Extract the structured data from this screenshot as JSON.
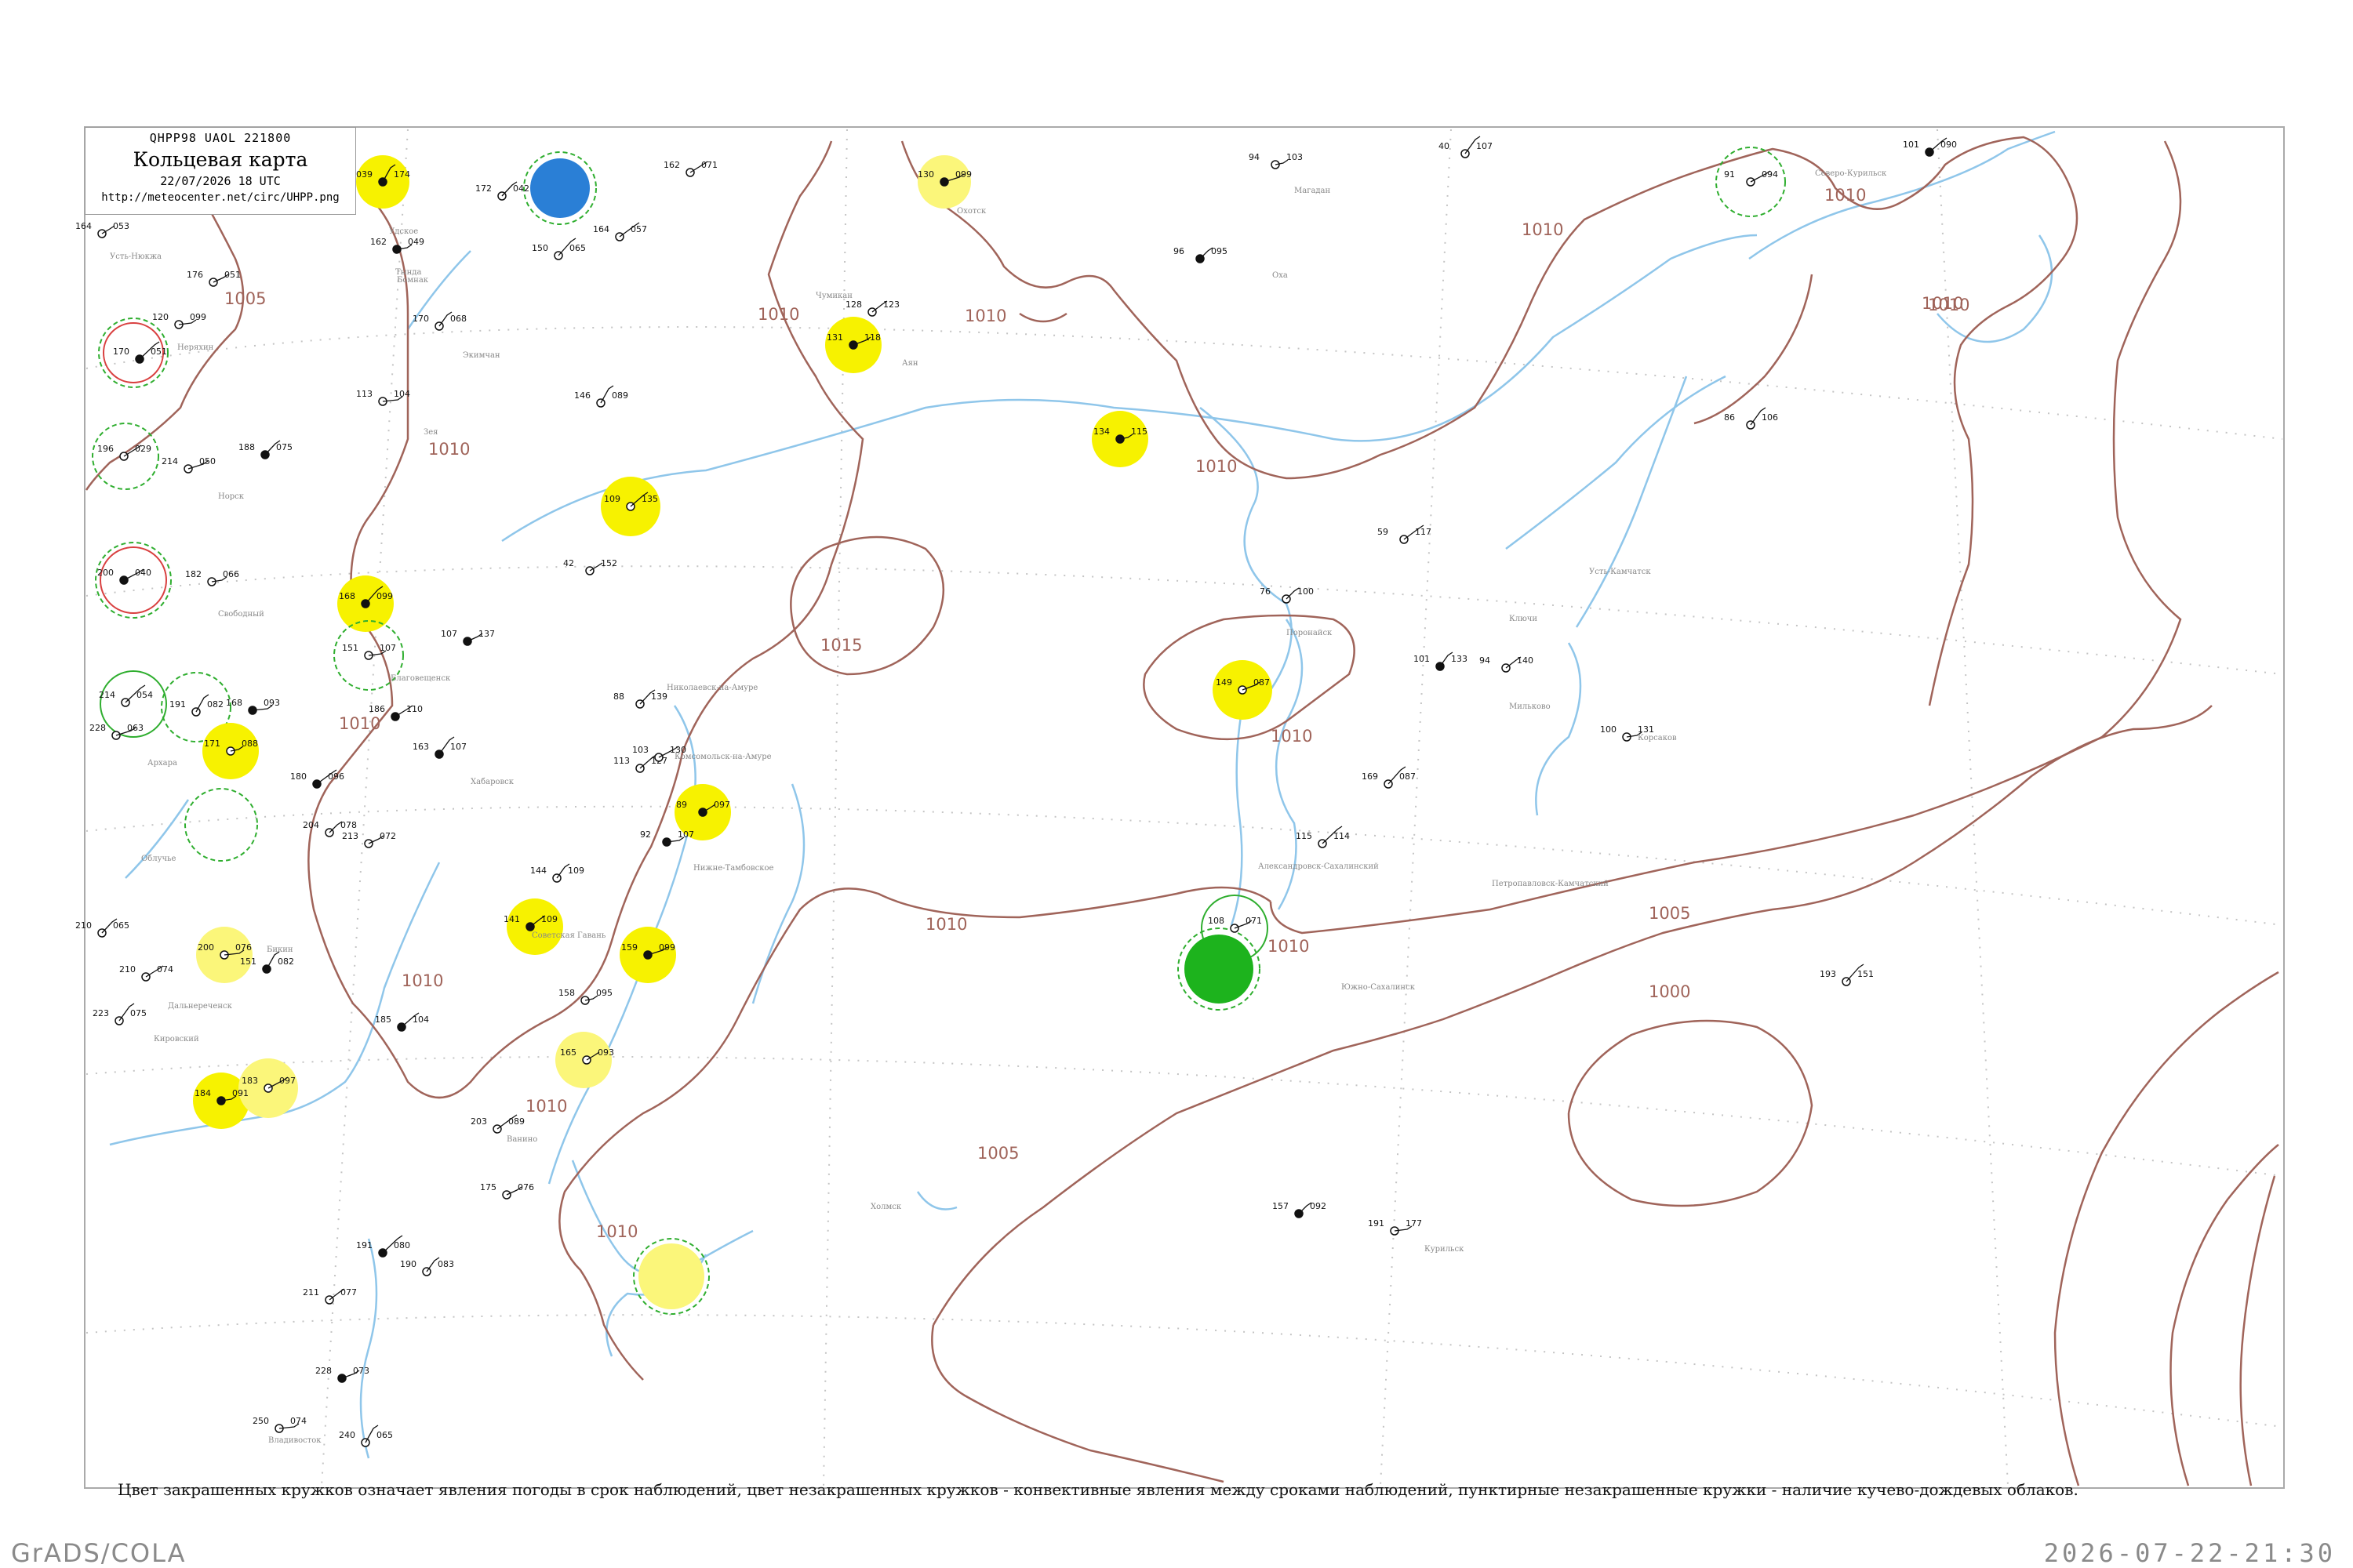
{
  "header": {
    "code": "QHPP98  UAOL  221800",
    "title": "Кольцевая карта",
    "datetime": "22/07/2026 18 UTC",
    "url": "http://meteocenter.net/circ/UHPP.png"
  },
  "caption": "Цвет закрашенных кружков означает явления погоды в срок наблюдений, цвет незакрашенных кружков - конвективные явления между сроками наблюдений, пунктирные незакрашенные кружки - наличие кучево-дождевых облаков.",
  "footer": {
    "left": "GrADS/COLA",
    "right": "2026-07-22-21:30"
  },
  "colors": {
    "isobar": "#a0645a",
    "coast": "#8fc6ea",
    "frame": "#aaaaaa",
    "fill_yellow": "#f7f200",
    "fill_yellow_light": "#fbf67a",
    "fill_blue": "#2a7fd6",
    "fill_green": "#1db31d",
    "ring_red": "#d94040",
    "ring_green": "#2fae2f"
  },
  "isobar_labels": [
    "1005",
    "1010",
    "1010",
    "1010",
    "1010",
    "1010",
    "1010",
    "1010",
    "1010",
    "1010",
    "1010",
    "1010",
    "1010",
    "1015",
    "1010",
    "1005",
    "1000",
    "1005",
    "1010",
    "1010"
  ],
  "stations": [
    {
      "name": "",
      "pressure": "174",
      "code": "039"
    },
    {
      "name": "",
      "pressure": "042",
      "code": "172"
    },
    {
      "name": "",
      "pressure": "071",
      "code": "162"
    },
    {
      "name": "",
      "pressure": "099",
      "code": "130"
    },
    {
      "name": "",
      "pressure": "103",
      "code": "94"
    },
    {
      "name": "",
      "pressure": "107",
      "code": "40"
    },
    {
      "name": "",
      "pressure": "090",
      "code": "101"
    },
    {
      "name": "",
      "pressure": "094",
      "code": "91"
    },
    {
      "name": "",
      "pressure": "053",
      "code": "164"
    },
    {
      "name": "",
      "pressure": "049",
      "code": "162"
    },
    {
      "name": "",
      "pressure": "065",
      "code": "150"
    },
    {
      "name": "",
      "pressure": "057",
      "code": "164"
    },
    {
      "name": "",
      "pressure": "095",
      "code": "96"
    },
    {
      "name": "",
      "pressure": "051",
      "code": "176"
    },
    {
      "name": "",
      "pressure": "099",
      "code": "120"
    },
    {
      "name": "",
      "pressure": "051",
      "code": "170"
    },
    {
      "name": "",
      "pressure": "068",
      "code": "170"
    },
    {
      "name": "",
      "pressure": "123",
      "code": "128"
    },
    {
      "name": "",
      "pressure": "118",
      "code": "131"
    },
    {
      "name": "",
      "pressure": "104",
      "code": "113"
    },
    {
      "name": "",
      "pressure": "089",
      "code": "146"
    },
    {
      "name": "",
      "pressure": "075",
      "code": "188"
    },
    {
      "name": "",
      "pressure": "029",
      "code": "196"
    },
    {
      "name": "",
      "pressure": "050",
      "code": "214"
    },
    {
      "name": "",
      "pressure": "115",
      "code": "134"
    },
    {
      "name": "",
      "pressure": "106",
      "code": "86"
    },
    {
      "name": "",
      "pressure": "135",
      "code": "109"
    },
    {
      "name": "",
      "pressure": "040",
      "code": "200"
    },
    {
      "name": "",
      "pressure": "152",
      "code": "42"
    },
    {
      "name": "",
      "pressure": "066",
      "code": "182"
    },
    {
      "name": "",
      "pressure": "099",
      "code": "168"
    },
    {
      "name": "",
      "pressure": "117",
      "code": "59"
    },
    {
      "name": "",
      "pressure": "100",
      "code": "76"
    },
    {
      "name": "",
      "pressure": "137",
      "code": "107"
    },
    {
      "name": "",
      "pressure": "107",
      "code": "151"
    },
    {
      "name": "",
      "pressure": "054",
      "code": "214"
    },
    {
      "name": "",
      "pressure": "133",
      "code": "101"
    },
    {
      "name": "",
      "pressure": "140",
      "code": "94"
    },
    {
      "name": "",
      "pressure": "087",
      "code": "149"
    },
    {
      "name": "",
      "pressure": "093",
      "code": "168"
    },
    {
      "name": "",
      "pressure": "082",
      "code": "191"
    },
    {
      "name": "",
      "pressure": "139",
      "code": "88"
    },
    {
      "name": "",
      "pressure": "110",
      "code": "186"
    },
    {
      "name": "",
      "pressure": "063",
      "code": "228"
    },
    {
      "name": "",
      "pressure": "088",
      "code": "171"
    },
    {
      "name": "",
      "pressure": "107",
      "code": "163"
    },
    {
      "name": "",
      "pressure": "127",
      "code": "113"
    },
    {
      "name": "",
      "pressure": "130",
      "code": "103"
    },
    {
      "name": "",
      "pressure": "097",
      "code": "89"
    },
    {
      "name": "",
      "pressure": "131",
      "code": "100"
    },
    {
      "name": "",
      "pressure": "087",
      "code": "169"
    },
    {
      "name": "",
      "pressure": "096",
      "code": "180"
    },
    {
      "name": "",
      "pressure": "078",
      "code": "204"
    },
    {
      "name": "",
      "pressure": "072",
      "code": "213"
    },
    {
      "name": "",
      "pressure": "107",
      "code": "92"
    },
    {
      "name": "",
      "pressure": "114",
      "code": "115"
    },
    {
      "name": "",
      "pressure": "109",
      "code": "144"
    },
    {
      "name": "",
      "pressure": "109",
      "code": "141"
    },
    {
      "name": "",
      "pressure": "071",
      "code": "108"
    },
    {
      "name": "",
      "pressure": "076",
      "code": "200"
    },
    {
      "name": "",
      "pressure": "082",
      "code": "151"
    },
    {
      "name": "",
      "pressure": "065",
      "code": "210"
    },
    {
      "name": "",
      "pressure": "074",
      "code": "210"
    },
    {
      "name": "",
      "pressure": "099",
      "code": "159"
    },
    {
      "name": "",
      "pressure": "095",
      "code": "158"
    },
    {
      "name": "",
      "pressure": "075",
      "code": "223"
    },
    {
      "name": "",
      "pressure": "104",
      "code": "185"
    },
    {
      "name": "",
      "pressure": "097",
      "code": "183"
    },
    {
      "name": "",
      "pressure": "093",
      "code": "165"
    },
    {
      "name": "",
      "pressure": "091",
      "code": "184"
    },
    {
      "name": "",
      "pressure": "151",
      "code": "193"
    },
    {
      "name": "",
      "pressure": "089",
      "code": "203"
    },
    {
      "name": "",
      "pressure": "092",
      "code": "157"
    },
    {
      "name": "",
      "pressure": "076",
      "code": "175"
    },
    {
      "name": "",
      "pressure": "177",
      "code": "191"
    },
    {
      "name": "",
      "pressure": "080",
      "code": "191"
    },
    {
      "name": "",
      "pressure": "083",
      "code": "190"
    },
    {
      "name": "",
      "pressure": "077",
      "code": "211"
    },
    {
      "name": "",
      "pressure": "073",
      "code": "228"
    },
    {
      "name": "",
      "pressure": "074",
      "code": "250"
    },
    {
      "name": "",
      "pressure": "065",
      "code": "240"
    }
  ],
  "place_names": [
    "Усть-Нюкжа",
    "Неряхин",
    "Тында",
    "Бомнак",
    "Экимчан",
    "Зея",
    "Норск",
    "Свободный",
    "Благовещенск",
    "Архара",
    "Облучье",
    "Хабаровск",
    "Бикин",
    "Дальнереченск",
    "Кировский",
    "Нижне-Тамбовское",
    "Комсомольск-на-Амуре",
    "Николаевск-на-Амуре",
    "Охотск",
    "Аян",
    "Чумикан",
    "Удское",
    "Магадан",
    "Северо-Курильск",
    "Южно-Сахалинск",
    "Оха",
    "Александровск-Сахалинский",
    "Поронайск",
    "Холмск",
    "Петропавловск-Камчатский",
    "Усть-Камчатск",
    "Ключи",
    "Мильково",
    "Корсаков",
    "Курильск",
    "Ванино",
    "Советская Гавань",
    "Владивосток"
  ]
}
